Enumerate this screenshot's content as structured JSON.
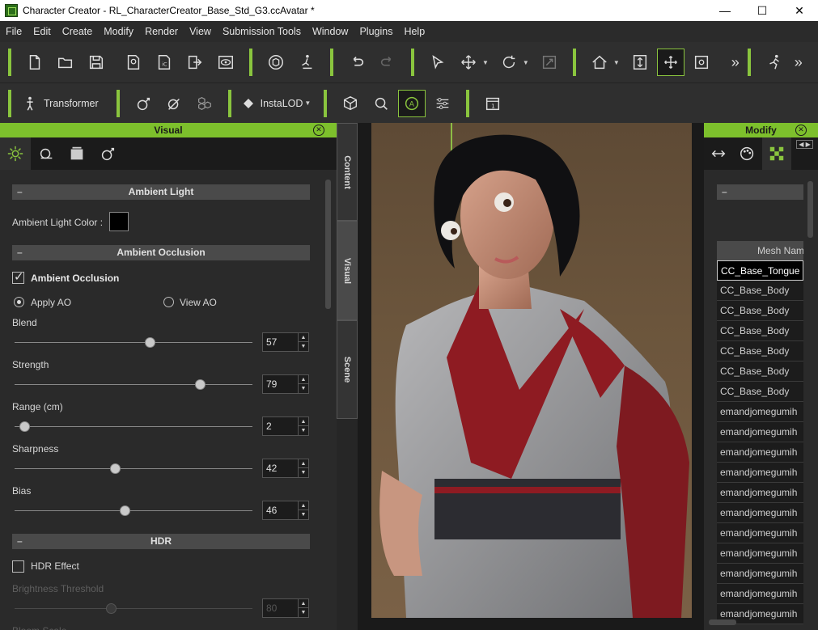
{
  "window": {
    "title": "Character Creator - RL_CharacterCreator_Base_Std_G3.ccAvatar *",
    "minimize": "—",
    "maximize": "☐",
    "close": "✕"
  },
  "menu": [
    "File",
    "Edit",
    "Create",
    "Modify",
    "Render",
    "View",
    "Submission Tools",
    "Window",
    "Plugins",
    "Help"
  ],
  "toolbar2": {
    "transformer_label": "Transformer",
    "instalod_label": "InstaLOD"
  },
  "visual_panel": {
    "title": "Visual",
    "tabs_vertical": [
      "Content",
      "Visual",
      "Scene"
    ],
    "ambient_light": {
      "header": "Ambient Light",
      "color_label": "Ambient Light Color :",
      "color": "#000000"
    },
    "ambient_occlusion": {
      "header": "Ambient Occlusion",
      "checkbox_label": "Ambient Occlusion",
      "checked": true,
      "apply_ao": "Apply AO",
      "view_ao": "View AO",
      "sliders": [
        {
          "label": "Blend",
          "value": "57",
          "fraction": 0.57
        },
        {
          "label": "Strength",
          "value": "79",
          "fraction": 0.79
        },
        {
          "label": "Range (cm)",
          "value": "2",
          "fraction": 0.02
        },
        {
          "label": "Sharpness",
          "value": "42",
          "fraction": 0.42
        },
        {
          "label": "Bias",
          "value": "46",
          "fraction": 0.46
        }
      ]
    },
    "hdr": {
      "header": "HDR",
      "checkbox_label": "HDR Effect",
      "checked": false,
      "brightness_label": "Brightness Threshold",
      "brightness_value": "80",
      "brightness_fraction": 0.4,
      "next_label": "Bloom Scale"
    }
  },
  "modify_panel": {
    "title": "Modify",
    "column_header": "Mesh Nam",
    "meshes": [
      "CC_Base_Tongue",
      "CC_Base_Body",
      "CC_Base_Body",
      "CC_Base_Body",
      "CC_Base_Body",
      "CC_Base_Body",
      "CC_Base_Body",
      "emandjomegumih",
      "emandjomegumih",
      "emandjomegumih",
      "emandjomegumih",
      "emandjomegumih",
      "emandjomegumih",
      "emandjomegumih",
      "emandjomegumih",
      "emandjomegumih",
      "emandjomegumih",
      "emandjomegumih"
    ],
    "selected_index": 0
  },
  "colors": {
    "accent": "#7dc02c",
    "panel": "#2a2a2a",
    "toolbar": "#2f2f2f"
  }
}
